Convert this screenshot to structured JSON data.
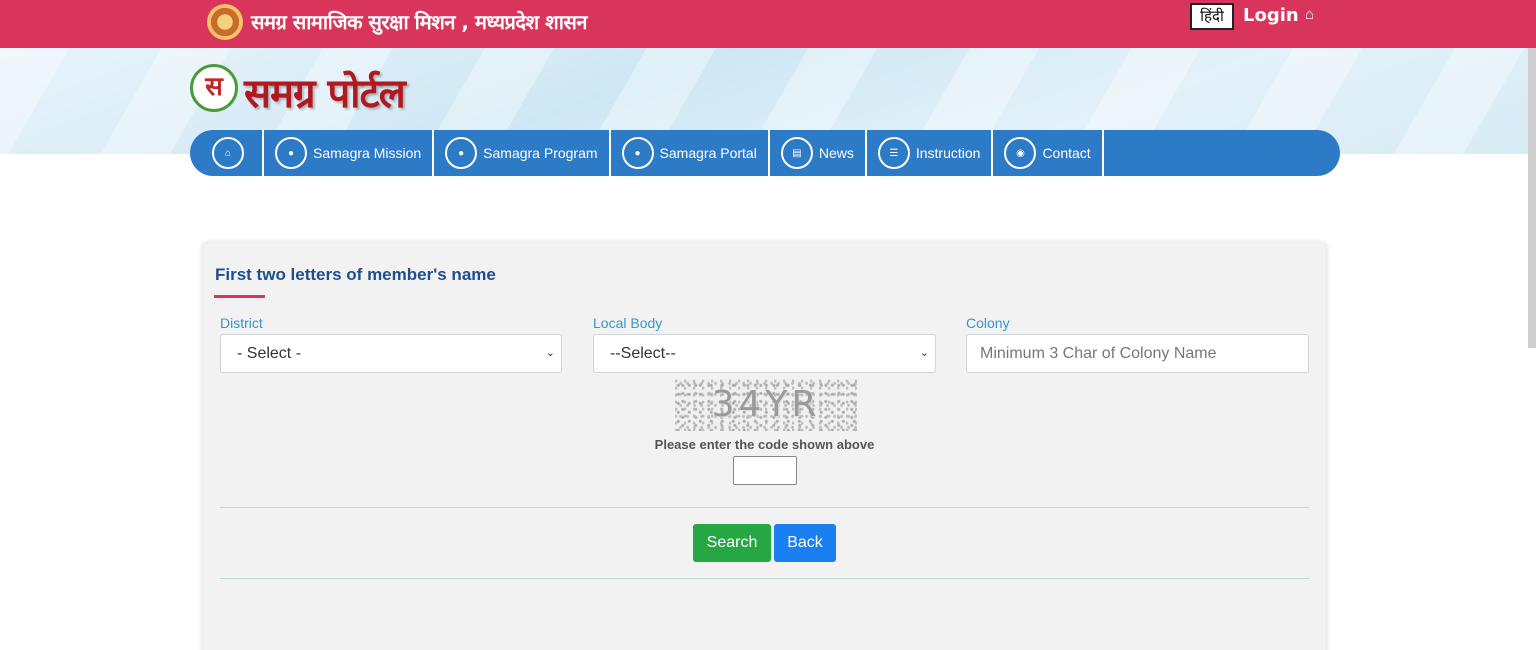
{
  "header": {
    "org_title": "समग्र सामाजिक सुरक्षा मिशन , मध्यप्रदेश शासन",
    "language_button": "हिंदी",
    "login_label": "Login",
    "home_icon": "home-icon"
  },
  "banner": {
    "logo_glyph": "स",
    "portal_title": "समग्र पोर्टल"
  },
  "nav": {
    "items": [
      {
        "label": "",
        "icon": "home-icon"
      },
      {
        "label": "Samagra Mission",
        "icon": "globe-icon"
      },
      {
        "label": "Samagra Program",
        "icon": "globe-icon"
      },
      {
        "label": "Samagra Portal",
        "icon": "globe-icon"
      },
      {
        "label": "News",
        "icon": "newspaper-icon"
      },
      {
        "label": "Instruction",
        "icon": "list-icon"
      },
      {
        "label": "Contact",
        "icon": "map-marker-icon"
      }
    ]
  },
  "form": {
    "title": "First two letters of member's name",
    "district": {
      "label": "District",
      "selected": "- Select -"
    },
    "local_body": {
      "label": "Local Body",
      "selected": "--Select--"
    },
    "colony": {
      "label": "Colony",
      "placeholder": "Minimum 3 Char of Colony Name",
      "value": ""
    },
    "captcha": {
      "code": "34YR",
      "hint": "Please enter the code shown above",
      "value": ""
    },
    "search_label": "Search",
    "back_label": "Back"
  },
  "colors": {
    "topbar": "#d9355c",
    "nav": "#2d7ac7",
    "title": "#1e4e8c",
    "search": "#26a744",
    "back": "#1a7ff0"
  }
}
